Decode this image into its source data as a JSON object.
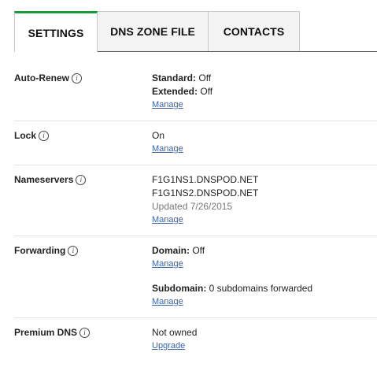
{
  "tabs": [
    {
      "label": "SETTINGS",
      "active": true
    },
    {
      "label": "DNS ZONE FILE",
      "active": false
    },
    {
      "label": "CONTACTS",
      "active": false
    }
  ],
  "auto_renew": {
    "label": "Auto-Renew",
    "standard_key": "Standard:",
    "standard_value": "Off",
    "extended_key": "Extended:",
    "extended_value": "Off",
    "link": "Manage"
  },
  "lock": {
    "label": "Lock",
    "value": "On",
    "link": "Manage"
  },
  "nameservers": {
    "label": "Nameservers",
    "ns1": "F1G1NS1.DNSPOD.NET",
    "ns2": "F1G1NS2.DNSPOD.NET",
    "updated": "Updated 7/26/2015",
    "link": "Manage"
  },
  "forwarding": {
    "label": "Forwarding",
    "domain_key": "Domain:",
    "domain_value": "Off",
    "domain_link": "Manage",
    "subdomain_key": "Subdomain:",
    "subdomain_value": "0 subdomains forwarded",
    "subdomain_link": "Manage"
  },
  "premium_dns": {
    "label": "Premium DNS",
    "value": "Not owned",
    "link": "Upgrade"
  },
  "colors": {
    "accent": "#1a9b3a",
    "link": "#3a64a8"
  },
  "icons": {
    "info": "info-icon"
  }
}
